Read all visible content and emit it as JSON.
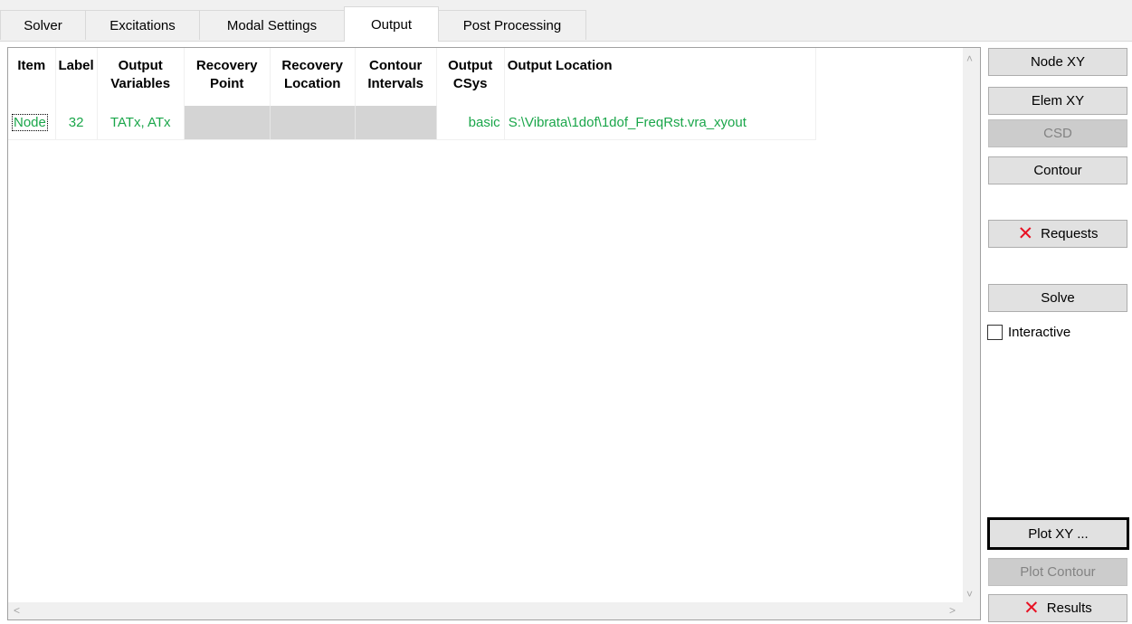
{
  "tabs": [
    {
      "label": "Solver"
    },
    {
      "label": "Excitations"
    },
    {
      "label": "Modal Settings"
    },
    {
      "label": "Output",
      "active": true
    },
    {
      "label": "Post Processing"
    }
  ],
  "table": {
    "headers": {
      "item": "Item",
      "label": "Label",
      "output_variables": [
        "Output",
        "Variables"
      ],
      "recovery_point": [
        "Recovery",
        "Point"
      ],
      "recovery_location": [
        "Recovery",
        "Location"
      ],
      "contour_intervals": [
        "Contour",
        "Intervals"
      ],
      "output_csys": [
        "Output",
        "CSys"
      ],
      "output_location": "Output Location"
    },
    "rows": [
      {
        "item": "Node",
        "label": "32",
        "output_variables": "TATx, ATx",
        "recovery_point": "",
        "recovery_location": "",
        "contour_intervals": "",
        "output_csys": "basic",
        "output_location": "S:\\Vibrata\\1dof\\1dof_FreqRst.vra_xyout"
      }
    ]
  },
  "buttons": {
    "node_xy": "Node XY",
    "elem_xy": "Elem XY",
    "csd": "CSD",
    "contour": "Contour",
    "requests": "Requests",
    "solve": "Solve",
    "plot_xy": "Plot XY ...",
    "plot_contour": "Plot Contour",
    "results": "Results"
  },
  "checkbox": {
    "interactive_label": "Interactive",
    "checked": false
  },
  "colors": {
    "output_text": "#1aa64a",
    "delete_icon": "#e81123"
  }
}
